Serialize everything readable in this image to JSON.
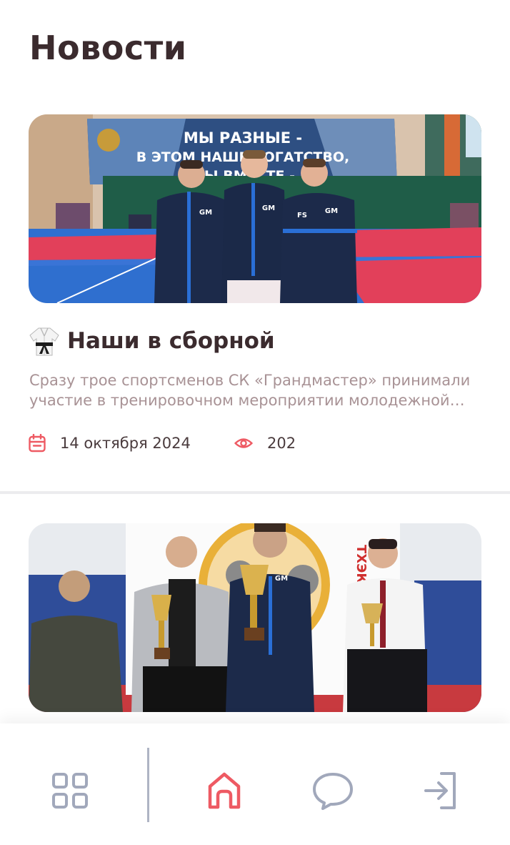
{
  "header": {
    "title": "Новости"
  },
  "colors": {
    "title": "#3b2b2e",
    "excerpt": "#a89295",
    "accent": "#ee5a63",
    "nav_inactive": "#a1a8bb"
  },
  "news": [
    {
      "emoji_icon": "martial-arts-uniform",
      "title": "Наши в сборной",
      "excerpt": "Сразу трое спортсменов СК «Грандмастер» принимали участие в тренировочном мероприятии молодежной сборной",
      "date": "14 октября 2024",
      "views": "202",
      "photo": {
        "banner_line1": "МЫ РАЗНЫЕ -",
        "banner_line2": "В ЭТОМ НАШЕ БОГАТСТВО,",
        "banner_line3": "МЫ ВМЕСТЕ -",
        "jacket_labels": [
          "GM",
          "GM",
          "FS",
          "GM"
        ]
      }
    },
    {
      "photo": {
        "jacket_label": "GM"
      }
    }
  ],
  "bottom_nav": {
    "items": [
      {
        "icon": "grid-icon",
        "active": false
      },
      {
        "icon": "home-icon",
        "active": true
      },
      {
        "icon": "chat-icon",
        "active": false
      },
      {
        "icon": "login-icon",
        "active": false
      }
    ]
  }
}
